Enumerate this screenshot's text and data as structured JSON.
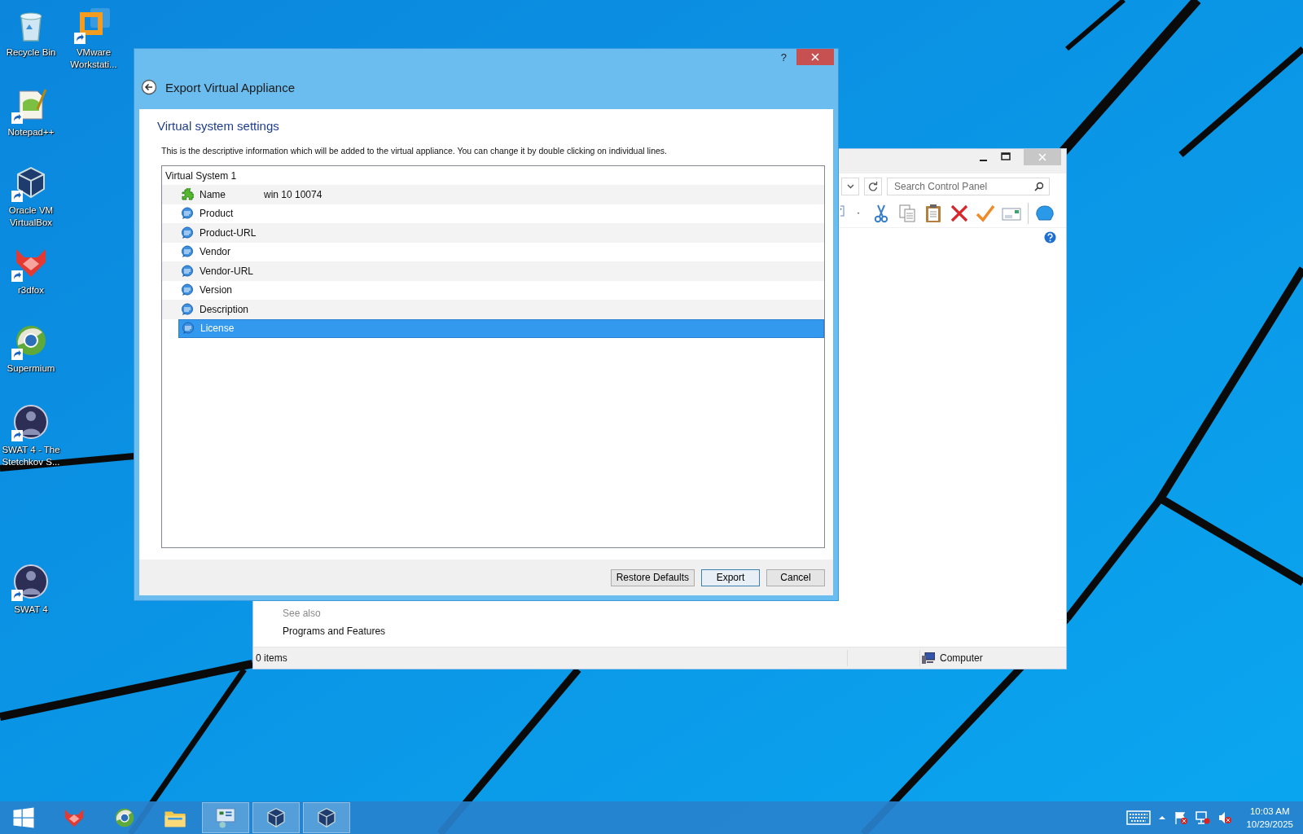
{
  "desktop_icons": [
    {
      "kind": "recycle",
      "label": "Recycle Bin",
      "shortcut": false
    },
    {
      "kind": "vmware",
      "label": "VMware Workstati...",
      "shortcut": true
    },
    {
      "kind": "notepad",
      "label": "Notepad++",
      "shortcut": true
    },
    {
      "kind": "virtualbox",
      "label": "Oracle VM VirtualBox",
      "shortcut": true
    },
    {
      "kind": "r3dfox",
      "label": "r3dfox",
      "shortcut": true
    },
    {
      "kind": "supermium",
      "label": "Supermium",
      "shortcut": true
    },
    {
      "kind": "swat",
      "label": "SWAT 4 - The Stetchkov S...",
      "shortcut": true
    },
    {
      "kind": "swat",
      "label": "SWAT 4",
      "shortcut": true
    }
  ],
  "back_window": {
    "search": {
      "placeholder": "Search Control Panel"
    },
    "see_also": "See also",
    "links": [
      "Programs and Features"
    ],
    "status_bar": {
      "items": "0 items",
      "location": "Computer"
    }
  },
  "dialog": {
    "help": "?",
    "title": "Export Virtual Appliance",
    "heading": "Virtual system settings",
    "description": "This is the descriptive information which will be added to the virtual appliance. You can change it by double clicking on individual lines.",
    "tree": {
      "label": "Virtual System 1",
      "children": [
        {
          "kind": "name",
          "label": "Name",
          "value": "win 10 10074",
          "selected": false
        },
        {
          "kind": "text",
          "label": "Product",
          "selected": false
        },
        {
          "kind": "text",
          "label": "Product-URL",
          "selected": false
        },
        {
          "kind": "text",
          "label": "Vendor",
          "selected": false
        },
        {
          "kind": "text",
          "label": "Vendor-URL",
          "selected": false
        },
        {
          "kind": "text",
          "label": "Version",
          "selected": false
        },
        {
          "kind": "text",
          "label": "Description",
          "selected": false
        },
        {
          "kind": "text",
          "label": "License",
          "selected": true
        }
      ]
    },
    "buttons": [
      {
        "label": "Restore Defaults",
        "default": false
      },
      {
        "label": "Export",
        "default": true
      },
      {
        "label": "Cancel",
        "default": false
      }
    ]
  },
  "taskbar": {
    "apps": [
      {
        "kind": "windows",
        "active": false
      },
      {
        "kind": "r3dfox",
        "active": false
      },
      {
        "kind": "supermium",
        "active": false
      },
      {
        "kind": "explorer",
        "active": false
      },
      {
        "kind": "control-panel",
        "active": true
      },
      {
        "kind": "virtualbox",
        "active": true
      },
      {
        "kind": "virtualbox",
        "active": true
      }
    ],
    "time": "10:03 AM",
    "date": "10/29/2025"
  }
}
